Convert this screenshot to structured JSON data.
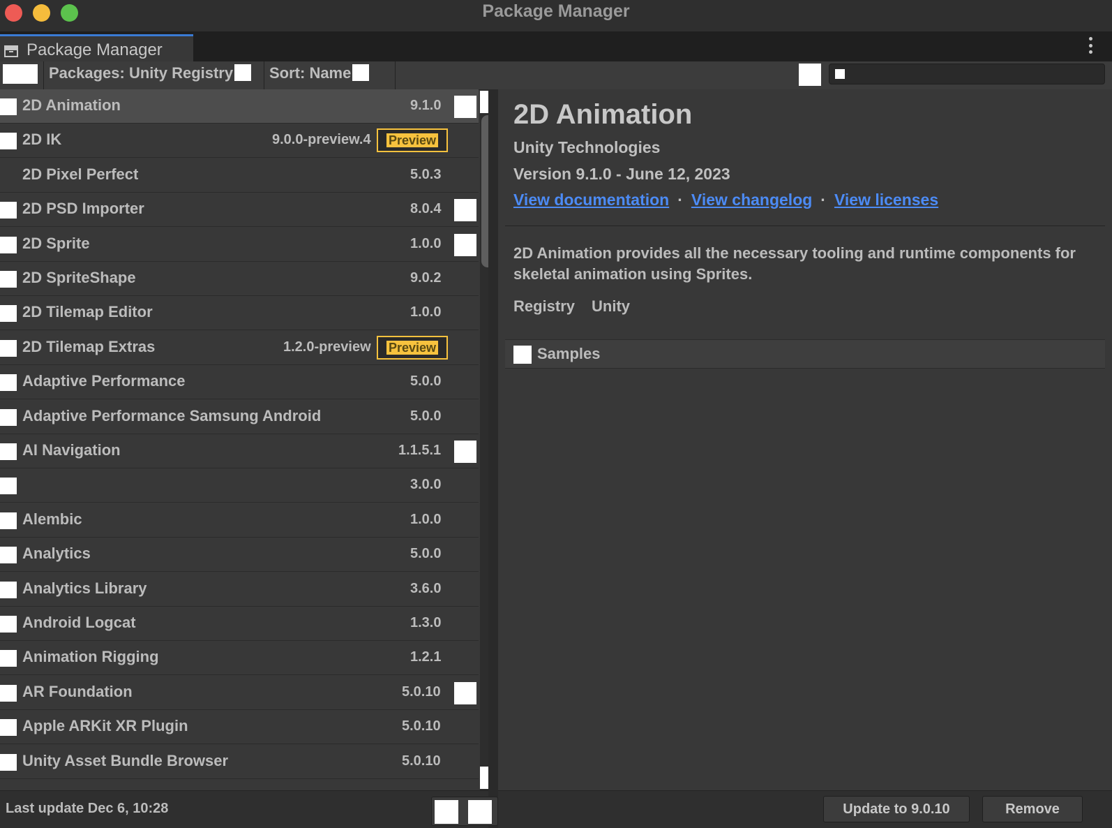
{
  "window": {
    "title": "Package Manager"
  },
  "tab": {
    "label": "Package Manager"
  },
  "toolbar": {
    "scope_dropdown": "Packages: Unity Registry",
    "sort_dropdown": "Sort: Name",
    "search_placeholder": ""
  },
  "packages": [
    {
      "name": "2D Animation",
      "version": "9.1.0",
      "badge": "",
      "status_icon": true,
      "selected": true,
      "check": true
    },
    {
      "name": "2D IK",
      "version": "9.0.0-preview.4",
      "badge": "Preview",
      "status_icon": false,
      "selected": false,
      "check": true
    },
    {
      "name": "2D Pixel Perfect",
      "version": "5.0.3",
      "badge": "",
      "status_icon": false,
      "selected": false,
      "check": false
    },
    {
      "name": "2D PSD Importer",
      "version": "8.0.4",
      "badge": "",
      "status_icon": true,
      "selected": false,
      "check": true
    },
    {
      "name": "2D Sprite",
      "version": "1.0.0",
      "badge": "",
      "status_icon": true,
      "selected": false,
      "check": true
    },
    {
      "name": "2D SpriteShape",
      "version": "9.0.2",
      "badge": "",
      "status_icon": false,
      "selected": false,
      "check": true
    },
    {
      "name": "2D Tilemap Editor",
      "version": "1.0.0",
      "badge": "",
      "status_icon": false,
      "selected": false,
      "check": true
    },
    {
      "name": "2D Tilemap Extras",
      "version": "1.2.0-preview",
      "badge": "Preview",
      "status_icon": false,
      "selected": false,
      "check": true
    },
    {
      "name": "Adaptive Performance",
      "version": "5.0.0",
      "badge": "",
      "status_icon": false,
      "selected": false,
      "check": true
    },
    {
      "name": "Adaptive Performance Samsung Android",
      "version": "5.0.0",
      "badge": "",
      "status_icon": false,
      "selected": false,
      "check": true
    },
    {
      "name": "AI Navigation",
      "version": "1.1.5.1",
      "badge": "",
      "status_icon": true,
      "selected": false,
      "check": true
    },
    {
      "name": "",
      "version": "3.0.0",
      "badge": "",
      "status_icon": false,
      "selected": false,
      "check": true
    },
    {
      "name": "Alembic",
      "version": "1.0.0",
      "badge": "",
      "status_icon": false,
      "selected": false,
      "check": true
    },
    {
      "name": "Analytics",
      "version": "5.0.0",
      "badge": "",
      "status_icon": false,
      "selected": false,
      "check": true
    },
    {
      "name": "Analytics Library",
      "version": "3.6.0",
      "badge": "",
      "status_icon": false,
      "selected": false,
      "check": true
    },
    {
      "name": "Android Logcat",
      "version": "1.3.0",
      "badge": "",
      "status_icon": false,
      "selected": false,
      "check": true
    },
    {
      "name": "Animation Rigging",
      "version": "1.2.1",
      "badge": "",
      "status_icon": false,
      "selected": false,
      "check": true
    },
    {
      "name": "AR Foundation",
      "version": "5.0.10",
      "badge": "",
      "status_icon": true,
      "selected": false,
      "check": true
    },
    {
      "name": "Apple ARKit XR Plugin",
      "version": "5.0.10",
      "badge": "",
      "status_icon": false,
      "selected": false,
      "check": true
    },
    {
      "name": "Unity Asset Bundle Browser",
      "version": "5.0.10",
      "badge": "",
      "status_icon": false,
      "selected": false,
      "check": true
    }
  ],
  "details": {
    "title": "2D Animation",
    "author": "Unity Technologies",
    "version_line": "Version 9.1.0 - June 12, 2023",
    "links": [
      "View documentation",
      "View changelog",
      "View licenses"
    ],
    "description": "2D Animation provides all the necessary tooling and runtime components for skeletal animation using Sprites.",
    "registry_label": "Registry",
    "registry_value": "Unity",
    "samples_label": "Samples"
  },
  "footer": {
    "last_update": "Last update Dec 6, 10:28",
    "update_button": "Update to 9.0.10",
    "remove_button": "Remove"
  },
  "colors": {
    "accent": "#3a7bd5",
    "link": "#4c8bf5",
    "preview_badge": "#f7c23e",
    "background": "#383838"
  }
}
